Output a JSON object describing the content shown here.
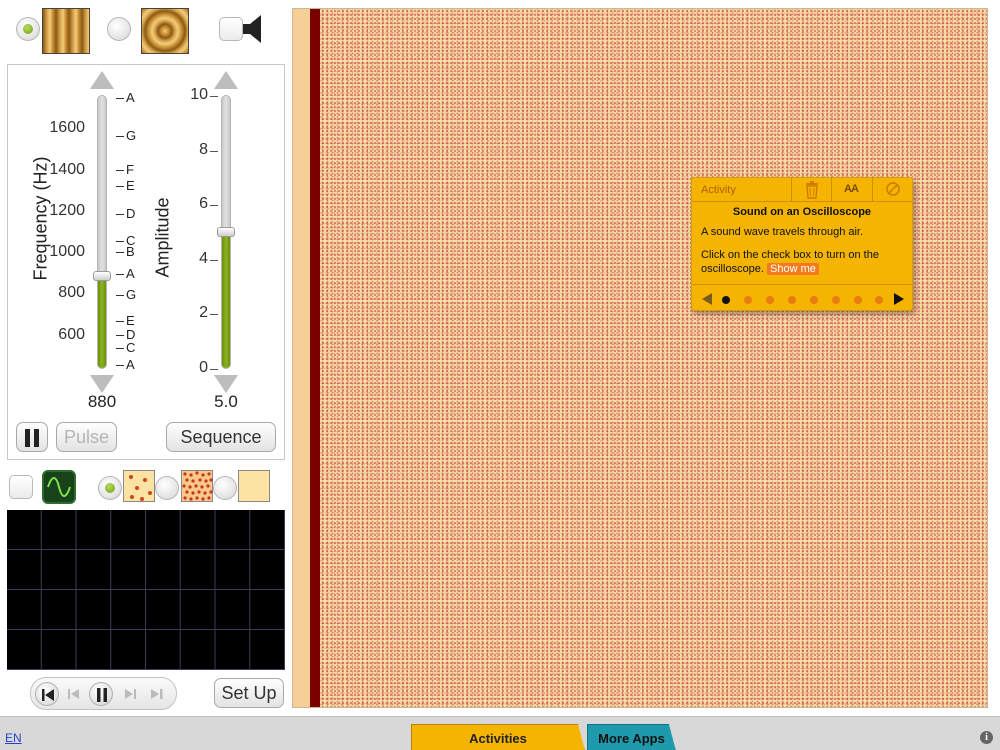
{
  "source": {
    "options": [
      {
        "name": "vertical-wave-source",
        "selected": true
      },
      {
        "name": "circular-wave-source",
        "selected": false
      }
    ],
    "sound_enabled": false
  },
  "frequency": {
    "axis_label": "Frequency (Hz)",
    "ticks": [
      "1600",
      "1400",
      "1200",
      "1000",
      "800",
      "600"
    ],
    "notes_top": [
      "A",
      "G",
      "F",
      "E",
      "D",
      "C",
      "B",
      "A",
      "G"
    ],
    "notes_bottom": [
      "E",
      "D",
      "C",
      "A"
    ],
    "value": "880",
    "value_number": 880,
    "range": [
      440,
      1760
    ]
  },
  "amplitude": {
    "axis_label": "Amplitude",
    "ticks": [
      "10",
      "8",
      "6",
      "4",
      "2",
      "0"
    ],
    "value": "5.0",
    "value_number": 5.0,
    "range": [
      0,
      10
    ]
  },
  "buttons": {
    "pause": "pause",
    "pulse": "Pulse",
    "sequence": "Sequence",
    "setup": "Set Up"
  },
  "oscilloscope": {
    "enabled": false,
    "density_selected": 1
  },
  "activity": {
    "title": "Activity",
    "heading": "Sound on an Oscilloscope",
    "line1": "A sound wave travels through air.",
    "line2": "Click on the check box to turn on the oscilloscope.",
    "show_me": "Show me",
    "step_count": 8,
    "current_step": 1,
    "icon_text_size": "AA"
  },
  "footer": {
    "language": "EN",
    "tab_activities": "Activities",
    "tab_more_apps": "More Apps",
    "info": "i"
  },
  "colors": {
    "slider_fill": "#8db420",
    "activity_bg": "#f4b400",
    "more_apps_bg": "#1e9aac",
    "speaker_bar": "#7a0000"
  }
}
